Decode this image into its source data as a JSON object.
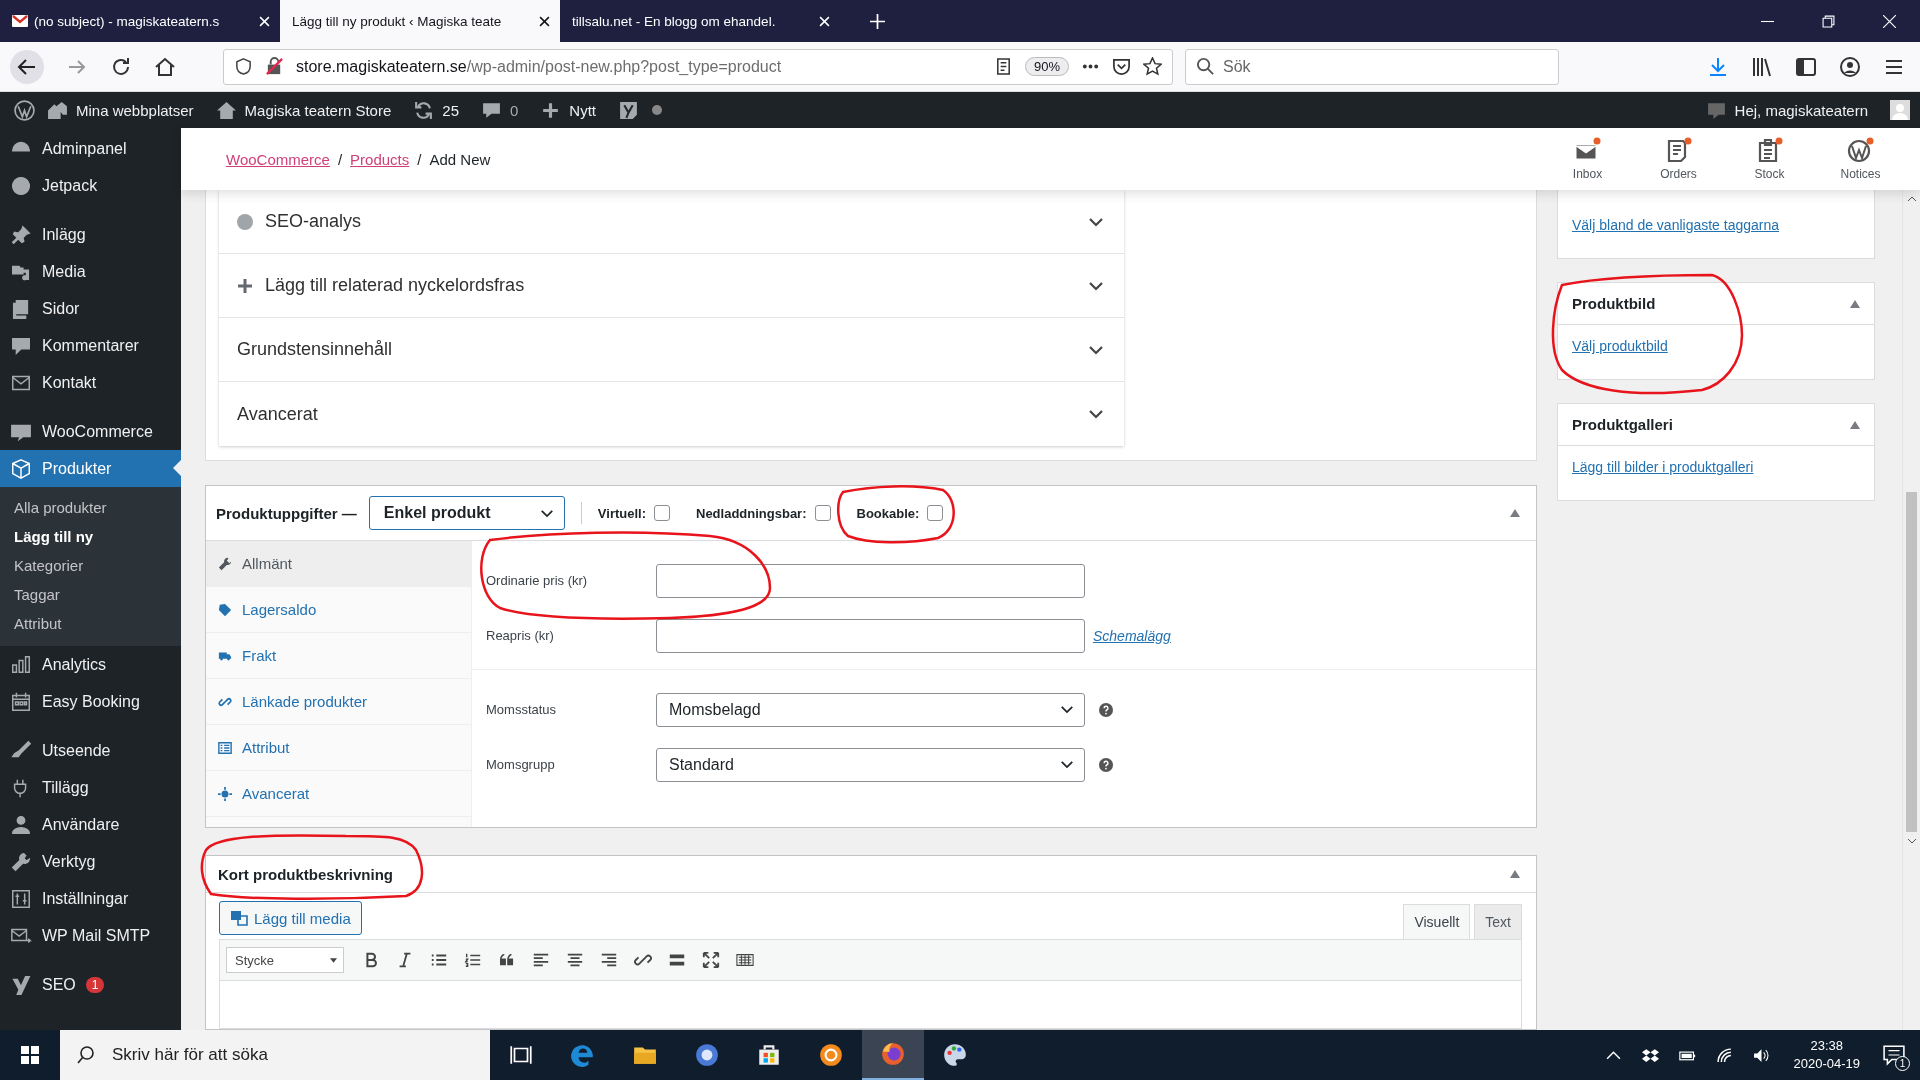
{
  "browser": {
    "tabs": [
      {
        "title": "(no subject) - magiskateatern.s",
        "selected": false
      },
      {
        "title": "Lägg till ny produkt ‹ Magiska teate",
        "selected": true
      },
      {
        "title": "tillsalu.net - En blogg om ehandel.",
        "selected": false
      }
    ],
    "url_host": "store.magiskateatern.se",
    "url_path": "/wp-admin/post-new.php?post_type=product",
    "zoom": "90%",
    "search_placeholder": "Sök"
  },
  "admin_bar": {
    "sites": "Mina webbplatser",
    "store": "Magiska teatern Store",
    "updates": "25",
    "comments": "0",
    "new": "Nytt",
    "greeting": "Hej, magiskateatern"
  },
  "sidebar": {
    "items": [
      {
        "label": "Adminpanel",
        "selected": false
      },
      {
        "label": "Jetpack",
        "selected": false
      },
      {
        "label": "Inlägg",
        "selected": false,
        "gap_before": true
      },
      {
        "label": "Media",
        "selected": false
      },
      {
        "label": "Sidor",
        "selected": false
      },
      {
        "label": "Kommentarer",
        "selected": false
      },
      {
        "label": "Kontakt",
        "selected": false
      },
      {
        "label": "WooCommerce",
        "selected": false,
        "gap_before": true
      },
      {
        "label": "Produkter",
        "selected": true,
        "children": [
          {
            "label": "Alla produkter",
            "selected": false
          },
          {
            "label": "Lägg till ny",
            "selected": true
          },
          {
            "label": "Kategorier",
            "selected": false
          },
          {
            "label": "Taggar",
            "selected": false
          },
          {
            "label": "Attribut",
            "selected": false
          }
        ]
      },
      {
        "label": "Analytics",
        "selected": false
      },
      {
        "label": "Easy Booking",
        "selected": false
      },
      {
        "label": "Utseende",
        "selected": false,
        "gap_before": true
      },
      {
        "label": "Tillägg",
        "selected": false
      },
      {
        "label": "Användare",
        "selected": false
      },
      {
        "label": "Verktyg",
        "selected": false
      },
      {
        "label": "Inställningar",
        "selected": false
      },
      {
        "label": "WP Mail SMTP",
        "selected": false
      },
      {
        "label": "SEO",
        "selected": false,
        "gap_before": true,
        "badge": "1"
      }
    ]
  },
  "breadcrumb": {
    "separator": "/",
    "items": [
      {
        "label": "WooCommerce",
        "link": true
      },
      {
        "label": "Products",
        "link": true
      },
      {
        "label": "Add New",
        "link": false
      }
    ]
  },
  "header_actions": [
    "Inbox",
    "Orders",
    "Stock",
    "Notices"
  ],
  "seo_sections": [
    {
      "label": "SEO-analys",
      "kind": "status"
    },
    {
      "label": "Lägg till relaterad nyckelordsfras",
      "kind": "add"
    },
    {
      "label": "Grundstensinnehåll",
      "kind": "plain"
    },
    {
      "label": "Avancerat",
      "kind": "plain"
    }
  ],
  "product_data": {
    "title": "Produktuppgifter —",
    "type": "Enkel produkt",
    "options": [
      {
        "label": "Virtuell:",
        "checked": false
      },
      {
        "label": "Nedladdningsbar:",
        "checked": false
      },
      {
        "label": "Bookable:",
        "checked": false
      }
    ],
    "tabs": [
      {
        "label": "Allmänt",
        "selected": true
      },
      {
        "label": "Lagersaldo",
        "selected": false
      },
      {
        "label": "Frakt",
        "selected": false
      },
      {
        "label": "Länkade produkter",
        "selected": false
      },
      {
        "label": "Attribut",
        "selected": false
      },
      {
        "label": "Avancerat",
        "selected": false
      }
    ],
    "fields": [
      {
        "label": "Ordinarie pris (kr)",
        "kind": "input"
      },
      {
        "label": "Reapris (kr)",
        "kind": "input",
        "link": "Schemalägg"
      },
      {
        "label": "Momsstatus",
        "kind": "select",
        "value": "Momsbelagd",
        "help": true,
        "divider": true
      },
      {
        "label": "Momsgrupp",
        "kind": "select",
        "value": "Standard",
        "help": true
      }
    ]
  },
  "side_boxes": [
    {
      "link": "Välj bland de vanligaste taggarna"
    },
    {
      "title": "Produktbild",
      "link": "Välj produktbild"
    },
    {
      "title": "Produktgalleri",
      "link": "Lägg till bilder i produktgalleri"
    }
  ],
  "short_description": {
    "title": "Kort produktbeskrivning",
    "add_media": "Lägg till media",
    "format": "Stycke",
    "tabs": [
      {
        "label": "Visuellt",
        "selected": true
      },
      {
        "label": "Text",
        "selected": false
      }
    ]
  },
  "taskbar": {
    "search_placeholder": "Skriv här för att söka",
    "time": "23:38",
    "date": "2020-04-19",
    "notifications": "1"
  }
}
